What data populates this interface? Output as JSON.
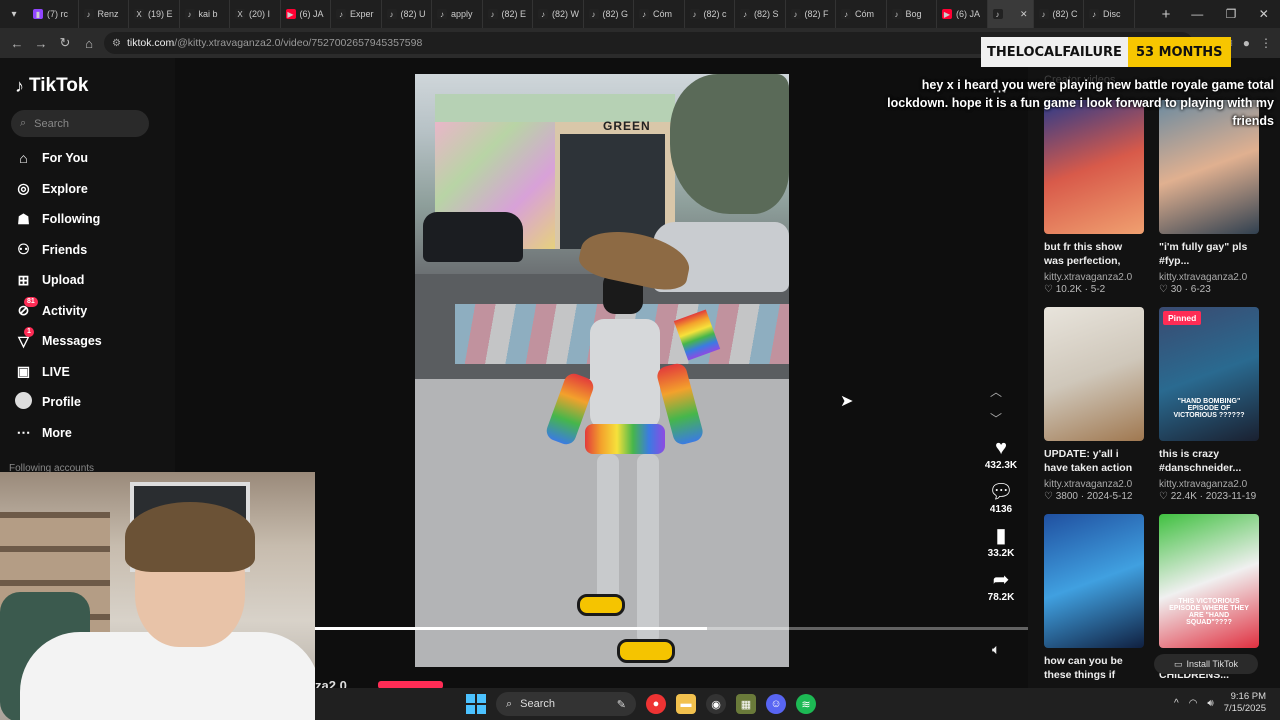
{
  "browser": {
    "tabs": [
      {
        "icon": "twitch-icon",
        "label": "(7) rc",
        "color": "#9146ff"
      },
      {
        "icon": "tiktok-icon",
        "label": "Renz",
        "color": "#222"
      },
      {
        "icon": "x-icon",
        "label": "(19) E",
        "color": "#222"
      },
      {
        "icon": "tiktok-icon",
        "label": "kai b",
        "color": "#222"
      },
      {
        "icon": "x-icon",
        "label": "(20) I",
        "color": "#222"
      },
      {
        "icon": "youtube-icon",
        "label": "(6) JA",
        "color": "#ff0033"
      },
      {
        "icon": "tiktok-icon",
        "label": "Exper",
        "color": "#222"
      },
      {
        "icon": "tiktok-icon",
        "label": "(82) U",
        "color": "#222"
      },
      {
        "icon": "tiktok-icon",
        "label": "apply",
        "color": "#222"
      },
      {
        "icon": "tiktok-icon",
        "label": "(82) E",
        "color": "#222"
      },
      {
        "icon": "tiktok-icon",
        "label": "(82) W",
        "color": "#222"
      },
      {
        "icon": "tiktok-icon",
        "label": "(82) G",
        "color": "#222"
      },
      {
        "icon": "tiktok-icon",
        "label": "Cóm",
        "color": "#222"
      },
      {
        "icon": "tiktok-icon",
        "label": "(82) c",
        "color": "#222"
      },
      {
        "icon": "tiktok-icon",
        "label": "(82) S",
        "color": "#222"
      },
      {
        "icon": "tiktok-icon",
        "label": "(82) F",
        "color": "#222"
      },
      {
        "icon": "tiktok-icon",
        "label": "Cóm",
        "color": "#222"
      },
      {
        "icon": "tiktok-icon",
        "label": "Bog",
        "color": "#222"
      },
      {
        "icon": "youtube-icon",
        "label": "(6) JA",
        "color": "#ff0033"
      },
      {
        "icon": "tiktok-icon",
        "label": "",
        "color": "#222",
        "active": true
      },
      {
        "icon": "tiktok-icon",
        "label": "(82) C",
        "color": "#222"
      },
      {
        "icon": "tiktok-icon",
        "label": "Disc",
        "color": "#222"
      }
    ],
    "url_host": "tiktok.com",
    "url_path": "/@kitty.xtravaganza2.0/video/7527002657945357598"
  },
  "sub_overlay": {
    "name": "THELOCALFAILURE",
    "months": "53 MONTHS"
  },
  "chat_overlay": "hey x i heard you were playing new battle royale game total lockdown. hope it is a fun game i look forward to playing with my friends",
  "sidebar": {
    "logo": "TikTok",
    "search_placeholder": "Search",
    "items": [
      {
        "label": "For You",
        "icon": "home-icon"
      },
      {
        "label": "Explore",
        "icon": "compass-icon"
      },
      {
        "label": "Following",
        "icon": "following-icon"
      },
      {
        "label": "Friends",
        "icon": "friends-icon"
      },
      {
        "label": "Upload",
        "icon": "upload-icon"
      },
      {
        "label": "Activity",
        "icon": "activity-icon",
        "badge": "81"
      },
      {
        "label": "Messages",
        "icon": "messages-icon",
        "badge": "1"
      },
      {
        "label": "LIVE",
        "icon": "live-icon"
      },
      {
        "label": "Profile",
        "icon": "profile-icon"
      },
      {
        "label": "More",
        "icon": "more-icon"
      }
    ],
    "following_accounts": "Following accounts"
  },
  "video": {
    "sign_text": "GREEN",
    "progress": 0.55,
    "author_peek": "za2.0",
    "actions": {
      "likes": "432.3K",
      "comments": "4136",
      "saves": "33.2K",
      "shares": "78.2K"
    }
  },
  "right_panel": {
    "header": "Creator videos",
    "cards": [
      {
        "caption": "but fr this show was perfection, blue ate...",
        "account": "kitty.xtravaganza2.0",
        "likes": "10.2K",
        "date": "5-2",
        "thumb": "linear-gradient(160deg,#2a3a8a,#d85a4a,#f0a070)"
      },
      {
        "caption": "\"i'm fully gay\" pls #fyp...",
        "account": "kitty.xtravaganza2.0",
        "likes": "30",
        "date": "6-23",
        "thumb": "linear-gradient(160deg,#6a8aa0,#e0b090,#304050)"
      },
      {
        "caption": "UPDATE: y'all i have taken action agains...",
        "account": "kitty.xtravaganza2.0",
        "likes": "3800",
        "date": "2024-5-12",
        "thumb": "linear-gradient(160deg,#e8e4dc,#cfc7ba,#a07850)"
      },
      {
        "caption": "this is crazy #danschneider...",
        "account": "kitty.xtravaganza2.0",
        "likes": "22.4K",
        "date": "2023-11-19",
        "thumb": "linear-gradient(160deg,#3a4a70,#2a6a90,#1a2030)",
        "pinned": "Pinned",
        "overtext": "\"HAND BOMBING\" EPISODE OF VICTORIOUS ??????"
      },
      {
        "caption": "how can you be these things if you'...",
        "account": "",
        "likes": "",
        "date": "",
        "thumb": "linear-gradient(160deg,#2050a0,#40a0e0,#102040)"
      },
      {
        "caption": "HOW was this a CHILDRENS...",
        "account": "",
        "likes": "",
        "date": "",
        "thumb": "linear-gradient(160deg,#40c040,#f0f0f0,#e03040)",
        "overtext": "THIS VICTORIOUS EPISODE WHERE THEY ARE \"HAND SQUAD\"????"
      }
    ],
    "install_label": "Install TikTok"
  },
  "taskbar": {
    "search_label": "Search",
    "time": "9:16 PM",
    "date": "7/15/2025"
  }
}
